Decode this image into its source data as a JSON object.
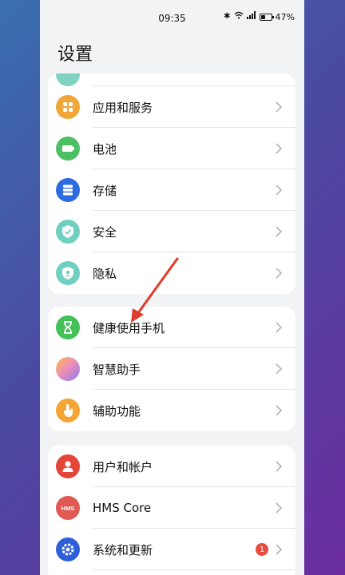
{
  "status_bar": {
    "time": "09:35",
    "battery": "47%",
    "battery_level": 0.47
  },
  "page": {
    "title": "设置"
  },
  "colors": {
    "app_services": "#f2a637",
    "battery": "#4cbf63",
    "storage": "#2d6be0",
    "security": "#6fcfc0",
    "privacy": "#6fcfc0",
    "digital_balance": "#43c058",
    "assistant": "#f08fb5",
    "accessibility": "#f4a534",
    "accounts": "#e5463a",
    "hms": "#e05a52",
    "system": "#2d5fd8",
    "annotation_arrow": "#e03a2c"
  },
  "group1": [
    {
      "label": "应用和服务",
      "icon": "grid-apps-icon"
    },
    {
      "label": "电池",
      "icon": "battery-icon"
    },
    {
      "label": "存储",
      "icon": "storage-icon"
    },
    {
      "label": "安全",
      "icon": "shield-check-icon"
    },
    {
      "label": "隐私",
      "icon": "privacy-shield-icon"
    }
  ],
  "group2": [
    {
      "label": "健康使用手机",
      "icon": "hourglass-icon"
    },
    {
      "label": "智慧助手",
      "icon": "assistant-orb-icon"
    },
    {
      "label": "辅助功能",
      "icon": "hand-pointer-icon"
    }
  ],
  "group3": [
    {
      "label": "用户和帐户",
      "icon": "user-icon"
    },
    {
      "label": "HMS Core",
      "icon": "hms-logo-icon",
      "icon_text": "HMS"
    },
    {
      "label": "系统和更新",
      "icon": "gear-icon",
      "badge": "1"
    }
  ]
}
